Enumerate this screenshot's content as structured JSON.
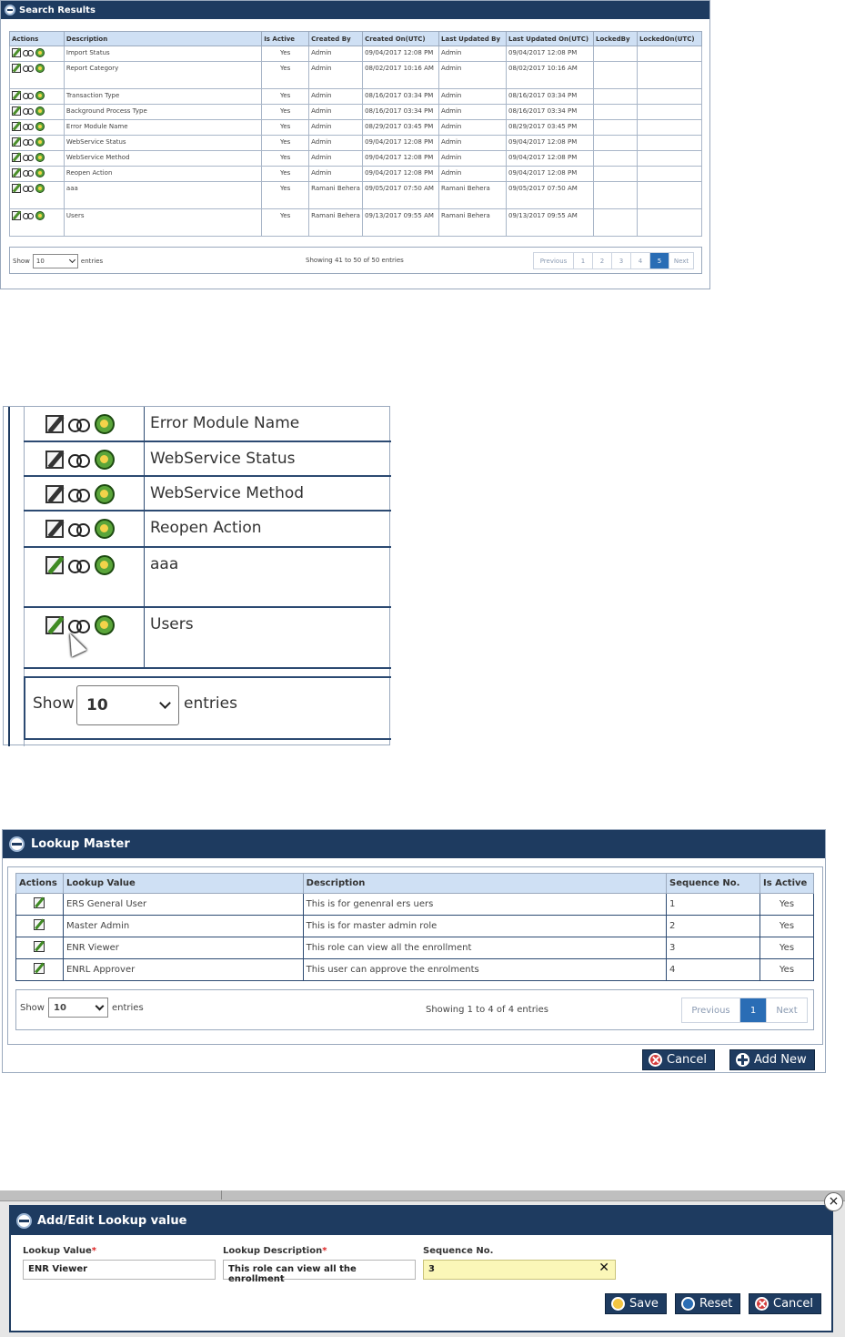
{
  "search_results": {
    "title": "Search Results",
    "columns": [
      "Actions",
      "Description",
      "Is Active",
      "Created By",
      "Created On(UTC)",
      "Last Updated By",
      "Last Updated On(UTC)",
      "LockedBy",
      "LockedOn(UTC)"
    ],
    "rows": [
      {
        "desc": "Import Status",
        "active": "Yes",
        "created_by": "Admin",
        "created_on": "09/04/2017 12:08 PM",
        "updated_by": "Admin",
        "updated_on": "09/04/2017 12:08 PM"
      },
      {
        "desc": "Report Category",
        "active": "Yes",
        "created_by": "Admin",
        "created_on": "08/02/2017 10:16 AM",
        "updated_by": "Admin",
        "updated_on": "08/02/2017 10:16 AM"
      },
      {
        "desc": "Transaction Type",
        "active": "Yes",
        "created_by": "Admin",
        "created_on": "08/16/2017 03:34 PM",
        "updated_by": "Admin",
        "updated_on": "08/16/2017 03:34 PM"
      },
      {
        "desc": "Background Process Type",
        "active": "Yes",
        "created_by": "Admin",
        "created_on": "08/16/2017 03:34 PM",
        "updated_by": "Admin",
        "updated_on": "08/16/2017 03:34 PM"
      },
      {
        "desc": "Error Module Name",
        "active": "Yes",
        "created_by": "Admin",
        "created_on": "08/29/2017 03:45 PM",
        "updated_by": "Admin",
        "updated_on": "08/29/2017 03:45 PM"
      },
      {
        "desc": "WebService Status",
        "active": "Yes",
        "created_by": "Admin",
        "created_on": "09/04/2017 12:08 PM",
        "updated_by": "Admin",
        "updated_on": "09/04/2017 12:08 PM"
      },
      {
        "desc": "WebService Method",
        "active": "Yes",
        "created_by": "Admin",
        "created_on": "09/04/2017 12:08 PM",
        "updated_by": "Admin",
        "updated_on": "09/04/2017 12:08 PM"
      },
      {
        "desc": "Reopen Action",
        "active": "Yes",
        "created_by": "Admin",
        "created_on": "09/04/2017 12:08 PM",
        "updated_by": "Admin",
        "updated_on": "09/04/2017 12:08 PM"
      },
      {
        "desc": "aaa",
        "active": "Yes",
        "created_by": "Ramani Behera",
        "created_on": "09/05/2017 07:50 AM",
        "updated_by": "Ramani Behera",
        "updated_on": "09/05/2017 07:50 AM"
      },
      {
        "desc": "Users",
        "active": "Yes",
        "created_by": "Ramani Behera",
        "created_on": "09/13/2017 09:55 AM",
        "updated_by": "Ramani Behera",
        "updated_on": "09/13/2017 09:55 AM"
      }
    ],
    "show_label": "Show",
    "entries_label": "entries",
    "page_size": "10",
    "info": "Showing 41 to 50 of 50 entries",
    "pager": {
      "previous": "Previous",
      "pages": [
        "1",
        "2",
        "3",
        "4",
        "5"
      ],
      "active": "5",
      "next": "Next"
    }
  },
  "zoom": {
    "rows": [
      "Error Module Name",
      "WebService Status",
      "WebService Method",
      "Reopen Action",
      "aaa",
      "Users"
    ],
    "show_label": "Show",
    "entries_label": "entries",
    "page_size": "10"
  },
  "lookup_master": {
    "title": "Lookup Master",
    "columns": [
      "Actions",
      "Lookup Value",
      "Description",
      "Sequence No.",
      "Is Active"
    ],
    "rows": [
      {
        "value": "ERS General User",
        "desc": "This is for genenral ers uers",
        "seq": "1",
        "active": "Yes"
      },
      {
        "value": "Master Admin",
        "desc": "This is for master admin role",
        "seq": "2",
        "active": "Yes"
      },
      {
        "value": "ENR Viewer",
        "desc": "This role can view all the enrollment",
        "seq": "3",
        "active": "Yes"
      },
      {
        "value": "ENRL Approver",
        "desc": "This user can approve the enrolments",
        "seq": "4",
        "active": "Yes"
      }
    ],
    "show_label": "Show",
    "entries_label": "entries",
    "page_size": "10",
    "info": "Showing 1 to 4 of 4 entries",
    "pager": {
      "previous": "Previous",
      "page": "1",
      "next": "Next"
    },
    "cancel_label": "Cancel",
    "add_new_label": "Add New"
  },
  "dialog": {
    "title": "Add/Edit Lookup value",
    "lookup_value_label": "Lookup Value",
    "lookup_value": "ENR Viewer",
    "lookup_desc_label": "Lookup Description",
    "lookup_desc": "This role can view all the enrollment",
    "seq_label": "Sequence No.",
    "seq_value": "3",
    "required_mark": "*",
    "clear_glyph": "✕",
    "close_glyph": "×",
    "save_label": "Save",
    "reset_label": "Reset",
    "cancel_label": "Cancel"
  },
  "colors": {
    "header_bg": "#1e3b60",
    "table_header_bg": "#cfe0f4",
    "pager_active": "#2a6db5",
    "highlight_input": "#fbf7b8"
  },
  "icons": [
    "globe-icon",
    "edit-icon",
    "view-icon",
    "cancel-icon",
    "add-icon",
    "save-icon",
    "reset-icon",
    "close-icon",
    "chevron-down-icon"
  ]
}
